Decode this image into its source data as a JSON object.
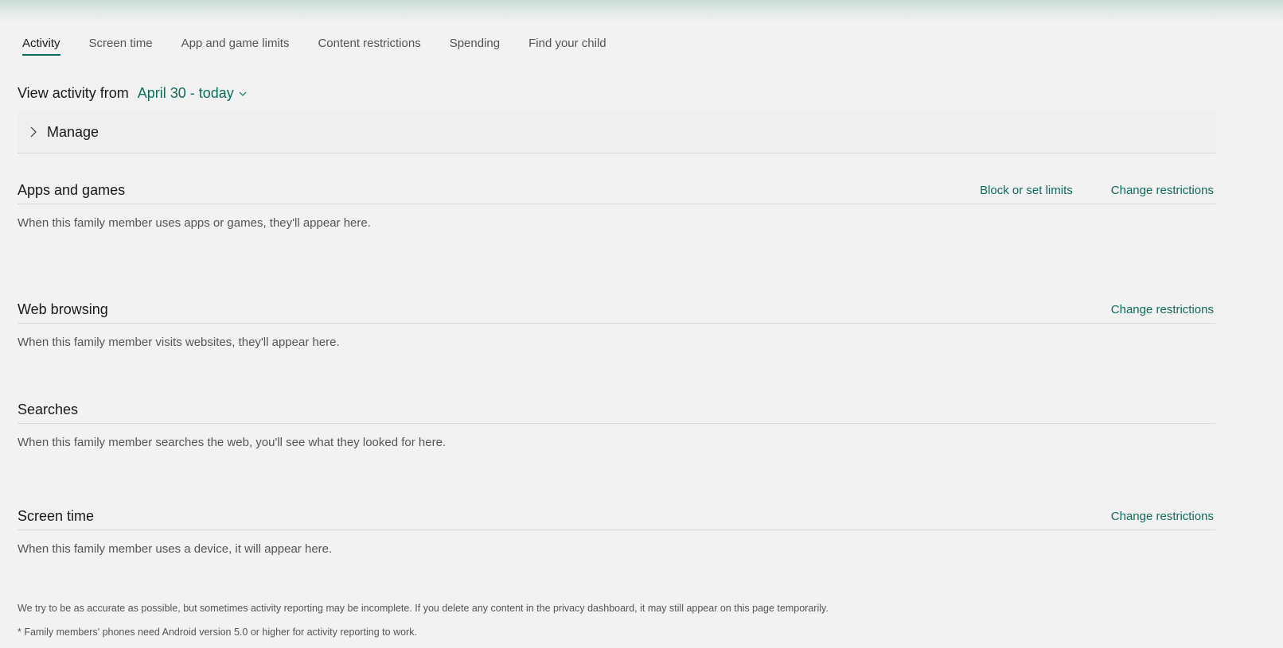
{
  "tabs": [
    {
      "label": "Activity",
      "active": true
    },
    {
      "label": "Screen time",
      "active": false
    },
    {
      "label": "App and game limits",
      "active": false
    },
    {
      "label": "Content restrictions",
      "active": false
    },
    {
      "label": "Spending",
      "active": false
    },
    {
      "label": "Find your child",
      "active": false
    }
  ],
  "view": {
    "label": "View activity from",
    "range": "April 30 - today"
  },
  "manage": {
    "label": "Manage"
  },
  "sections": {
    "apps": {
      "title": "Apps and games",
      "block_link": "Block or set limits",
      "change_link": "Change restrictions",
      "desc": "When this family member uses apps or games, they'll appear here."
    },
    "web": {
      "title": "Web browsing",
      "change_link": "Change restrictions",
      "desc": "When this family member visits websites, they'll appear here."
    },
    "searches": {
      "title": "Searches",
      "desc": "When this family member searches the web, you'll see what they looked for here."
    },
    "screen": {
      "title": "Screen time",
      "change_link": "Change restrictions",
      "desc": "When this family member uses a device, it will appear here."
    }
  },
  "footnotes": {
    "accuracy": "We try to be as accurate as possible, but sometimes activity reporting may be incomplete. If you delete any content in the privacy dashboard, it may still appear on this page temporarily.",
    "android": "* Family members' phones need Android version 5.0 or higher for activity reporting to work."
  },
  "colors": {
    "accent": "#0e6e5c",
    "background": "#f2f2f2"
  },
  "icons": {
    "date_dropdown": "chevron-down-icon",
    "manage_expand": "chevron-right-icon"
  }
}
